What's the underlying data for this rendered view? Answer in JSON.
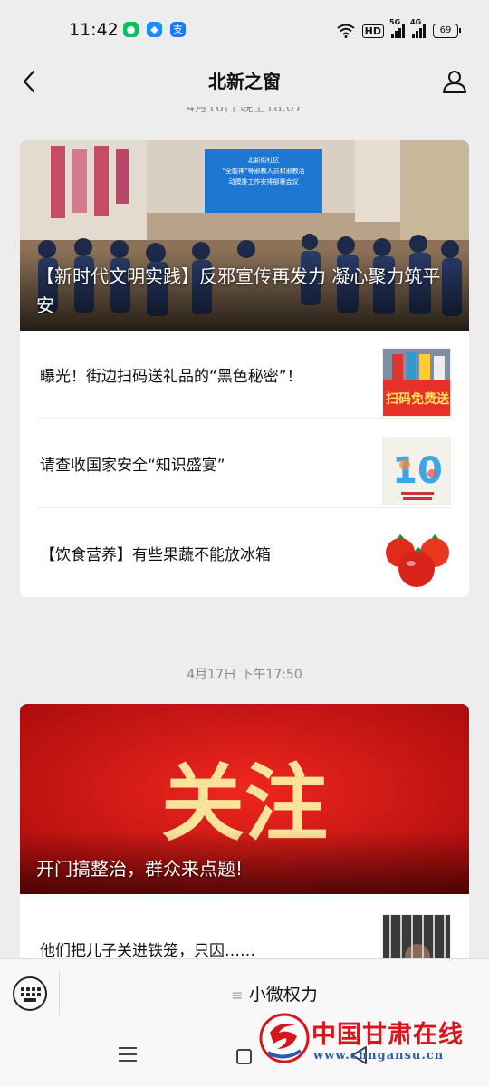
{
  "status_bar": {
    "time": "11:42",
    "apps": [
      {
        "name": "wechat-icon",
        "color": "#07c160",
        "glyph": "●"
      },
      {
        "name": "browser-icon",
        "color": "#1a8cff",
        "glyph": "◆"
      },
      {
        "name": "alipay-icon",
        "color": "#1677ff",
        "glyph": "支"
      }
    ],
    "hd_label": "HD",
    "sim1_label": "5G",
    "sim2_label": "4G",
    "battery": "69"
  },
  "nav": {
    "title": "北新之窗"
  },
  "feed": {
    "groups": [
      {
        "timestamp": "4月16日 晚上18:07",
        "cover": {
          "title": "【新时代文明实践】反邪宣传再发力 凝心聚力筑平安",
          "screen_lines": [
            "北新街社区",
            "“全能神”等邪教人员和邪教活",
            "动摸排工作安排部署会议"
          ]
        },
        "items": [
          {
            "title": "曝光！街边扫码送礼品的“黑色秘密”！",
            "thumb_text": "扫码免费送"
          },
          {
            "title": "请查收国家安全“知识盛宴”",
            "thumb_text": "10"
          },
          {
            "title": "【饮食营养】有些果蔬不能放冰箱",
            "thumb_text": ""
          }
        ]
      },
      {
        "timestamp": "4月17日 下午17:50",
        "cover": {
          "title": "开门搞整治，群众来点题!",
          "big_text": "关注"
        },
        "items": [
          {
            "title": "他们把儿子关进铁笼，只因……",
            "thumb_text": ""
          }
        ]
      }
    ]
  },
  "bottom_menu": {
    "menu_label": "小微权力"
  },
  "watermark": {
    "name": "中国甘肃在线",
    "url": "www.chngansu.cn"
  },
  "colors": {
    "accent_red": "#d8151d",
    "background": "#ededed"
  }
}
